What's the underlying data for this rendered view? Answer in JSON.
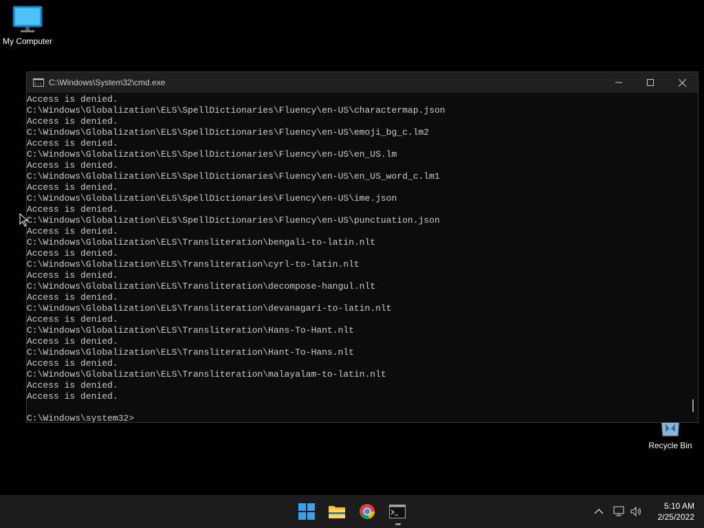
{
  "desktop": {
    "icons": [
      {
        "label": "My Computer",
        "icon": "monitor-icon"
      },
      {
        "label": "Recycle Bin",
        "icon": "recycle-bin-icon"
      }
    ]
  },
  "window": {
    "title": "C:\\Windows\\System32\\cmd.exe",
    "controls": [
      "minimize",
      "maximize",
      "close"
    ]
  },
  "console": {
    "lines": [
      "Access is denied.",
      "C:\\Windows\\Globalization\\ELS\\SpellDictionaries\\Fluency\\en-US\\charactermap.json",
      "Access is denied.",
      "C:\\Windows\\Globalization\\ELS\\SpellDictionaries\\Fluency\\en-US\\emoji_bg_c.lm2",
      "Access is denied.",
      "C:\\Windows\\Globalization\\ELS\\SpellDictionaries\\Fluency\\en-US\\en_US.lm",
      "Access is denied.",
      "C:\\Windows\\Globalization\\ELS\\SpellDictionaries\\Fluency\\en-US\\en_US_word_c.lm1",
      "Access is denied.",
      "C:\\Windows\\Globalization\\ELS\\SpellDictionaries\\Fluency\\en-US\\ime.json",
      "Access is denied.",
      "C:\\Windows\\Globalization\\ELS\\SpellDictionaries\\Fluency\\en-US\\punctuation.json",
      "Access is denied.",
      "C:\\Windows\\Globalization\\ELS\\Transliteration\\bengali-to-latin.nlt",
      "Access is denied.",
      "C:\\Windows\\Globalization\\ELS\\Transliteration\\cyrl-to-latin.nlt",
      "Access is denied.",
      "C:\\Windows\\Globalization\\ELS\\Transliteration\\decompose-hangul.nlt",
      "Access is denied.",
      "C:\\Windows\\Globalization\\ELS\\Transliteration\\devanagari-to-latin.nlt",
      "Access is denied.",
      "C:\\Windows\\Globalization\\ELS\\Transliteration\\Hans-To-Hant.nlt",
      "Access is denied.",
      "C:\\Windows\\Globalization\\ELS\\Transliteration\\Hant-To-Hans.nlt",
      "Access is denied.",
      "C:\\Windows\\Globalization\\ELS\\Transliteration\\malayalam-to-latin.nlt",
      "Access is denied.",
      "Access is denied.",
      "",
      "C:\\Windows\\system32>"
    ]
  },
  "taskbar": {
    "apps": [
      "start-button",
      "file-explorer",
      "chrome",
      "command-prompt"
    ],
    "active_app": "command-prompt",
    "tray_icons": [
      "chevron-up-icon",
      "network-icon",
      "volume-icon"
    ],
    "time": "5:10 AM",
    "date": "2/25/2022"
  }
}
